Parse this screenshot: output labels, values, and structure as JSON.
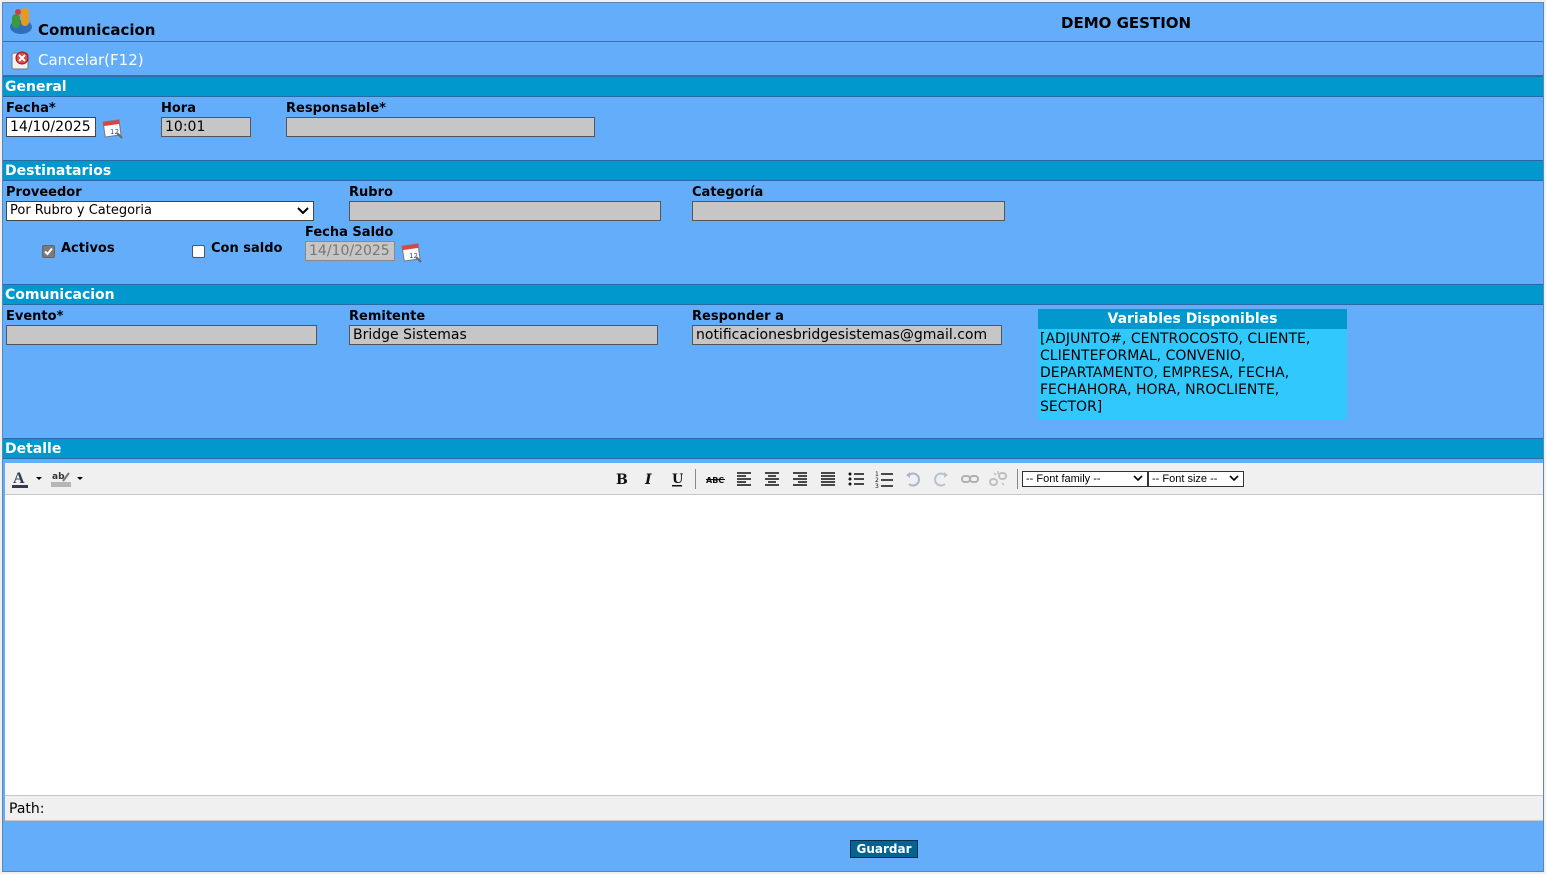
{
  "window": {
    "title": "Comunicacion",
    "company": "DEMO GESTION"
  },
  "toolbar": {
    "cancel_label": "Cancelar(F12)"
  },
  "general": {
    "section_title": "General",
    "fecha_label": "Fecha*",
    "fecha_value": "14/10/2025",
    "hora_label": "Hora",
    "hora_value": "10:01",
    "responsable_label": "Responsable*",
    "responsable_value": ""
  },
  "destinatarios": {
    "section_title": "Destinatarios",
    "proveedor_label": "Proveedor",
    "proveedor_selected": "Por Rubro y Categoria",
    "rubro_label": "Rubro",
    "rubro_value": "",
    "categoria_label": "Categoría",
    "categoria_value": "",
    "activos_label": "Activos",
    "activos_checked": true,
    "con_saldo_label": "Con saldo",
    "con_saldo_checked": false,
    "fecha_saldo_label": "Fecha Saldo",
    "fecha_saldo_value": "14/10/2025"
  },
  "comunicacion": {
    "section_title": "Comunicacion",
    "evento_label": "Evento*",
    "evento_value": "",
    "remitente_label": "Remitente",
    "remitente_value": "Bridge Sistemas",
    "responder_label": "Responder a",
    "responder_value": "notificacionesbridgesistemas@gmail.com",
    "variables_title": "Variables Disponibles",
    "variables_text": "[ADJUNTO#, CENTROCOSTO, CLIENTE, CLIENTEFORMAL, CONVENIO, DEPARTAMENTO, EMPRESA, FECHA, FECHAHORA, HORA, NROCLIENTE, SECTOR]"
  },
  "detalle": {
    "section_title": "Detalle",
    "font_family_placeholder": "-- Font family --",
    "font_size_placeholder": "-- Font size --",
    "path_label": "Path:",
    "icons": [
      "font-color-icon",
      "highlight-color-icon",
      "bold-icon",
      "italic-icon",
      "underline-icon",
      "strikethrough-icon",
      "align-left-icon",
      "align-center-icon",
      "align-right-icon",
      "align-justify-icon",
      "bullet-list-icon",
      "numbered-list-icon",
      "undo-icon",
      "redo-icon",
      "link-icon",
      "unlink-icon"
    ]
  },
  "footer": {
    "save_label": "Guardar"
  }
}
